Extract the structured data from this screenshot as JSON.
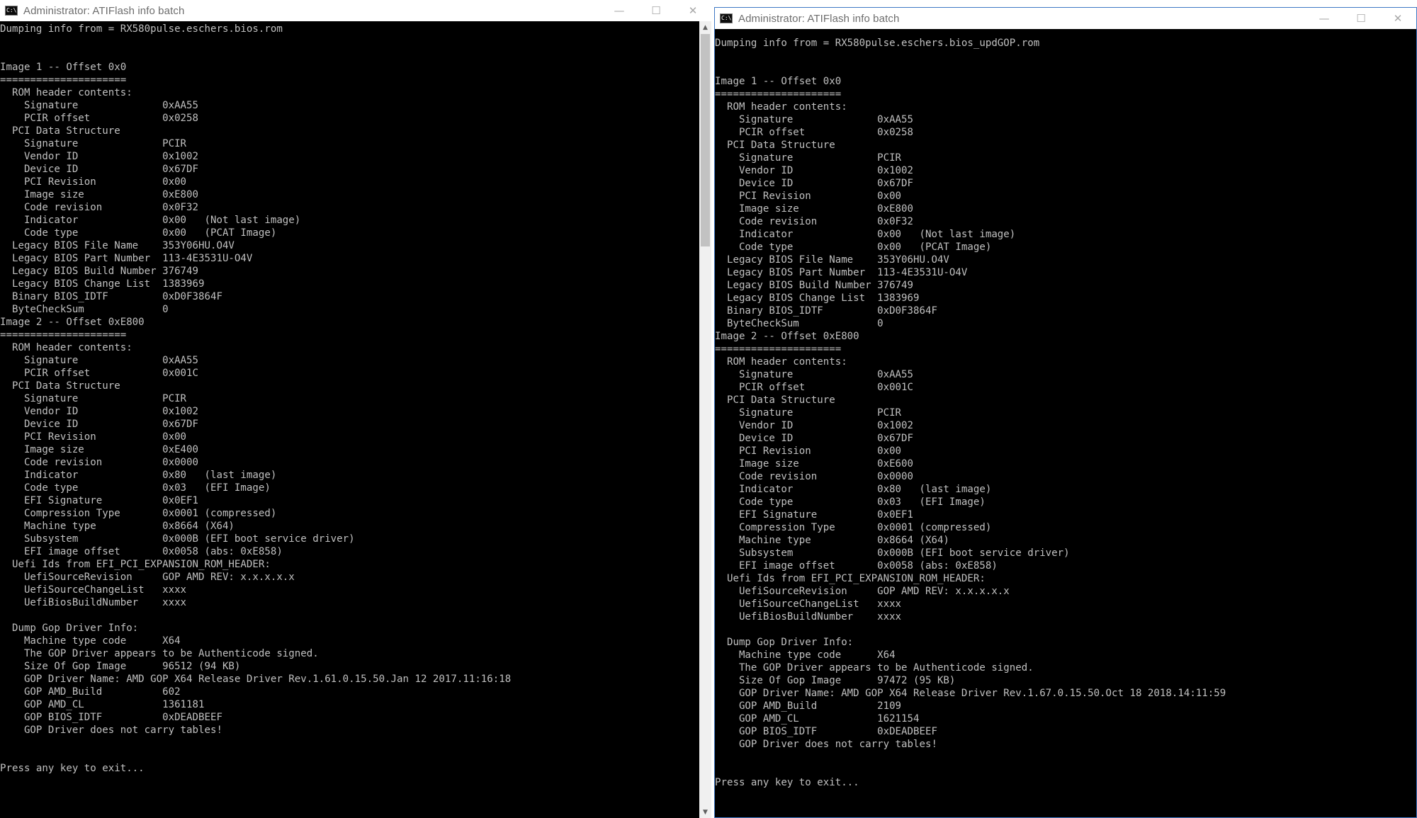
{
  "windows": [
    {
      "title": "Administrator:  ATIFlash info batch",
      "lines": [
        "Dumping info from = RX580pulse.eschers.bios.rom",
        "",
        "",
        "Image 1 -- Offset 0x0",
        "=====================",
        "  ROM header contents:",
        "    Signature              0xAA55",
        "    PCIR offset            0x0258",
        "  PCI Data Structure",
        "    Signature              PCIR",
        "    Vendor ID              0x1002",
        "    Device ID              0x67DF",
        "    PCI Revision           0x00",
        "    Image size             0xE800",
        "    Code revision          0x0F32",
        "    Indicator              0x00   (Not last image)",
        "    Code type              0x00   (PCAT Image)",
        "  Legacy BIOS File Name    353Y06HU.O4V",
        "  Legacy BIOS Part Number  113-4E3531U-O4V",
        "  Legacy BIOS Build Number 376749",
        "  Legacy BIOS Change List  1383969",
        "  Binary BIOS_IDTF         0xD0F3864F",
        "  ByteCheckSum             0",
        "Image 2 -- Offset 0xE800",
        "=====================",
        "  ROM header contents:",
        "    Signature              0xAA55",
        "    PCIR offset            0x001C",
        "  PCI Data Structure",
        "    Signature              PCIR",
        "    Vendor ID              0x1002",
        "    Device ID              0x67DF",
        "    PCI Revision           0x00",
        "    Image size             0xE400",
        "    Code revision          0x0000",
        "    Indicator              0x80   (last image)",
        "    Code type              0x03   (EFI Image)",
        "    EFI Signature          0x0EF1",
        "    Compression Type       0x0001 (compressed)",
        "    Machine type           0x8664 (X64)",
        "    Subsystem              0x000B (EFI boot service driver)",
        "    EFI image offset       0x0058 (abs: 0xE858)",
        "  Uefi Ids from EFI_PCI_EXPANSION_ROM_HEADER:",
        "    UefiSourceRevision     GOP AMD REV: x.x.x.x.x",
        "    UefiSourceChangeList   xxxx",
        "    UefiBiosBuildNumber    xxxx",
        "",
        "  Dump Gop Driver Info:",
        "    Machine type code      X64",
        "    The GOP Driver appears to be Authenticode signed.",
        "    Size Of Gop Image      96512 (94 KB)",
        "    GOP Driver Name: AMD GOP X64 Release Driver Rev.1.61.0.15.50.Jan 12 2017.11:16:18",
        "    GOP AMD_Build          602",
        "    GOP AMD_CL             1361181",
        "    GOP BIOS_IDTF          0xDEADBEEF",
        "    GOP Driver does not carry tables!",
        "",
        "",
        "Press any key to exit..."
      ]
    },
    {
      "title": "Administrator:  ATIFlash info batch",
      "lines": [
        "Dumping info from = RX580pulse.eschers.bios_updGOP.rom",
        "",
        "",
        "Image 1 -- Offset 0x0",
        "=====================",
        "  ROM header contents:",
        "    Signature              0xAA55",
        "    PCIR offset            0x0258",
        "  PCI Data Structure",
        "    Signature              PCIR",
        "    Vendor ID              0x1002",
        "    Device ID              0x67DF",
        "    PCI Revision           0x00",
        "    Image size             0xE800",
        "    Code revision          0x0F32",
        "    Indicator              0x00   (Not last image)",
        "    Code type              0x00   (PCAT Image)",
        "  Legacy BIOS File Name    353Y06HU.O4V",
        "  Legacy BIOS Part Number  113-4E3531U-O4V",
        "  Legacy BIOS Build Number 376749",
        "  Legacy BIOS Change List  1383969",
        "  Binary BIOS_IDTF         0xD0F3864F",
        "  ByteCheckSum             0",
        "Image 2 -- Offset 0xE800",
        "=====================",
        "  ROM header contents:",
        "    Signature              0xAA55",
        "    PCIR offset            0x001C",
        "  PCI Data Structure",
        "    Signature              PCIR",
        "    Vendor ID              0x1002",
        "    Device ID              0x67DF",
        "    PCI Revision           0x00",
        "    Image size             0xE600",
        "    Code revision          0x0000",
        "    Indicator              0x80   (last image)",
        "    Code type              0x03   (EFI Image)",
        "    EFI Signature          0x0EF1",
        "    Compression Type       0x0001 (compressed)",
        "    Machine type           0x8664 (X64)",
        "    Subsystem              0x000B (EFI boot service driver)",
        "    EFI image offset       0x0058 (abs: 0xE858)",
        "  Uefi Ids from EFI_PCI_EXPANSION_ROM_HEADER:",
        "    UefiSourceRevision     GOP AMD REV: x.x.x.x.x",
        "    UefiSourceChangeList   xxxx",
        "    UefiBiosBuildNumber    xxxx",
        "",
        "  Dump Gop Driver Info:",
        "    Machine type code      X64",
        "    The GOP Driver appears to be Authenticode signed.",
        "    Size Of Gop Image      97472 (95 KB)",
        "    GOP Driver Name: AMD GOP X64 Release Driver Rev.1.67.0.15.50.Oct 18 2018.14:11:59",
        "    GOP AMD_Build          2109",
        "    GOP AMD_CL             1621154",
        "    GOP BIOS_IDTF          0xDEADBEEF",
        "    GOP Driver does not carry tables!",
        "",
        "",
        "Press any key to exit..."
      ]
    }
  ],
  "icons": {
    "app": "cmd-icon",
    "minimize": "minimize-icon",
    "maximize": "maximize-icon",
    "close": "close-icon",
    "scroll_up": "scroll-up-arrow-icon",
    "scroll_down": "scroll-down-arrow-icon"
  },
  "colors": {
    "console_bg": "#000000",
    "console_text": "#c0c0c0",
    "titlebar_bg": "#ffffff",
    "title_text": "#6d6d6d",
    "active_border": "#3e78c4"
  }
}
